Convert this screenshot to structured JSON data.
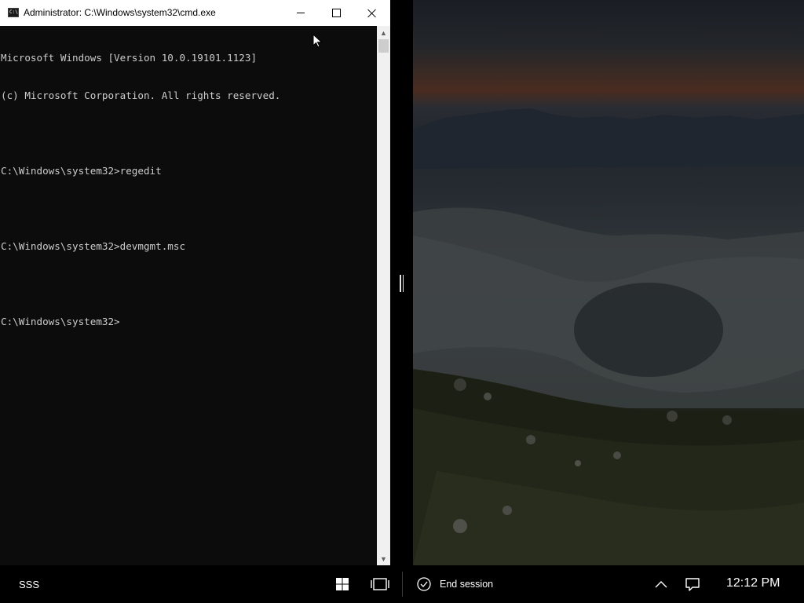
{
  "cmd_window": {
    "title": "Administrator: C:\\Windows\\system32\\cmd.exe",
    "app_icon_text": "C:\\",
    "console_lines": [
      "Microsoft Windows [Version 10.0.19101.1123]",
      "(c) Microsoft Corporation. All rights reserved.",
      "",
      "C:\\Windows\\system32>regedit",
      "",
      "C:\\Windows\\system32>devmgmt.msc",
      "",
      "C:\\Windows\\system32>"
    ],
    "minimize_icon": "minimize-icon",
    "maximize_icon": "maximize-icon",
    "close_icon": "close-icon"
  },
  "taskbar": {
    "session_name": "SSS",
    "start_icon": "windows-start-icon",
    "task_view_icon": "task-view-icon",
    "end_session_icon": "check-circle-icon",
    "end_session_label": "End session",
    "tray_chevron_icon": "chevron-up-icon",
    "notification_icon": "action-center-icon",
    "clock": "12:12 PM"
  },
  "colors": {
    "console_bg": "#0c0c0c",
    "console_fg": "#cccccc",
    "titlebar_bg": "#ffffff",
    "taskbar_bg": "#000000"
  }
}
